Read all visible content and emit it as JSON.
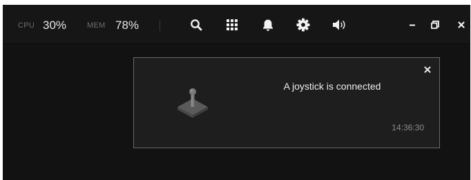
{
  "topbar": {
    "cpu": {
      "label": "CPU",
      "value": "30%"
    },
    "mem": {
      "label": "MEM",
      "value": "78%"
    },
    "icons": [
      "search-icon",
      "apps-grid-icon",
      "bell-icon",
      "gear-icon",
      "volume-icon"
    ],
    "window_controls": [
      "minimize-icon",
      "restore-icon",
      "close-icon"
    ]
  },
  "notification": {
    "message": "A joystick is connected",
    "time": "14:36:30",
    "icon": "joystick-icon"
  },
  "colors": {
    "background": "#121212",
    "topbar": "#161616",
    "panel": "#1e1e1e",
    "panel_border": "#6a6a6a",
    "text": "#ededed",
    "muted": "#8c8c8c"
  }
}
